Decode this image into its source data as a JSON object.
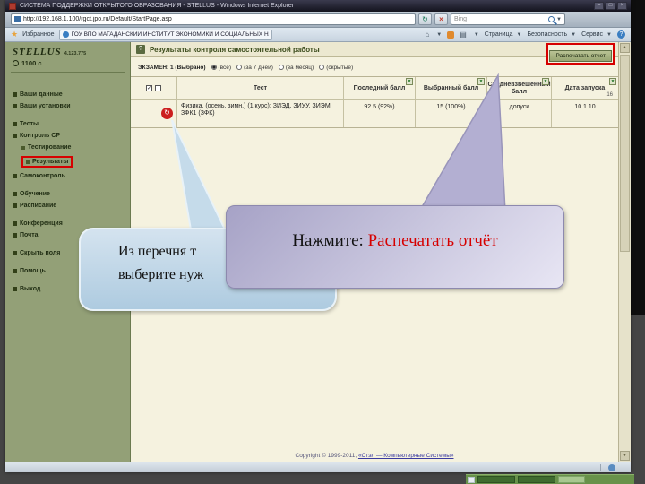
{
  "colors": {
    "annotation_red": "#d60000",
    "sidebar_green": "#93a077",
    "callout_blue": "#c5dbea",
    "callout_purple": "#b3afd2",
    "content_cream": "#f5f2df"
  },
  "titlebar": {
    "title": "СИСТЕМА ПОДДЕРЖКИ ОТКРЫТОГО ОБРАЗОВАНИЯ - STELLUS - Windows Internet Explorer",
    "minimize": "–",
    "maximize": "□",
    "close": "×"
  },
  "addressbar": {
    "url": "http://192.168.1.100/rgct.jpo.ru/Default/StartPage.asp",
    "refresh_glyph": "↻",
    "stop_glyph": "×",
    "search_text": "Bing"
  },
  "favbar": {
    "favorites_label": "Избранное",
    "tab_title": "ГОУ ВПО МАГАДАНСКИЙ ИНСТИТУТ ЭКОНОМИКИ И СОЦИАЛЬНЫХ НАУК...",
    "page_label": "Страница",
    "safety_label": "Безопасность",
    "tools_label": "Сервис",
    "help_glyph": "?"
  },
  "sidebar": {
    "logo": "STELLUS",
    "version": "4.123.775",
    "credit": "1100 с",
    "items": [
      "Ваши данные",
      "Ваши установки",
      "Тесты",
      "Контроль СР",
      "Тестирование",
      "Результаты",
      "Самоконтроль",
      "Обучение",
      "Расписание",
      "Конференция",
      "Почта",
      "Скрыть поля",
      "Помощь",
      "Выход"
    ]
  },
  "content": {
    "title": "Результаты контроля самостоятельной работы",
    "help_glyph": "?",
    "print_button": "Распечатать отчет",
    "filter_label": "ЭКЗАМЕН: 1 (Выбрано)",
    "filter_options": [
      "(все)",
      "(за 7 дней)",
      "(за месяц)",
      "(скрытые)"
    ],
    "table": {
      "headers": {
        "test": "Тест",
        "last": "Последний балл",
        "chosen": "Выбранный балл",
        "weighted": "Средневзвешенный балл",
        "date": "Дата запуска"
      },
      "launches": "16",
      "run_glyph": "↻",
      "row": {
        "test": "Физика. (осень, зимн.) (1 курс): ЗИЭД, ЗИУУ, ЗИЭМ, ЗФК1 (ЗФК)",
        "last": "92.5 (92%)",
        "chosen": "15 (100%)",
        "weighted": "допуск",
        "date": "10.1.10"
      }
    },
    "copyright_prefix": "Copyright © 1999-2011, ",
    "copyright_link": "«Стэл — Компьютерные Системы»"
  },
  "callouts": {
    "left_line1": "Из перечня т",
    "left_line2": "выберите нуж",
    "right_prefix": "Нажмите: ",
    "right_action": "Распечатать отчёт"
  }
}
